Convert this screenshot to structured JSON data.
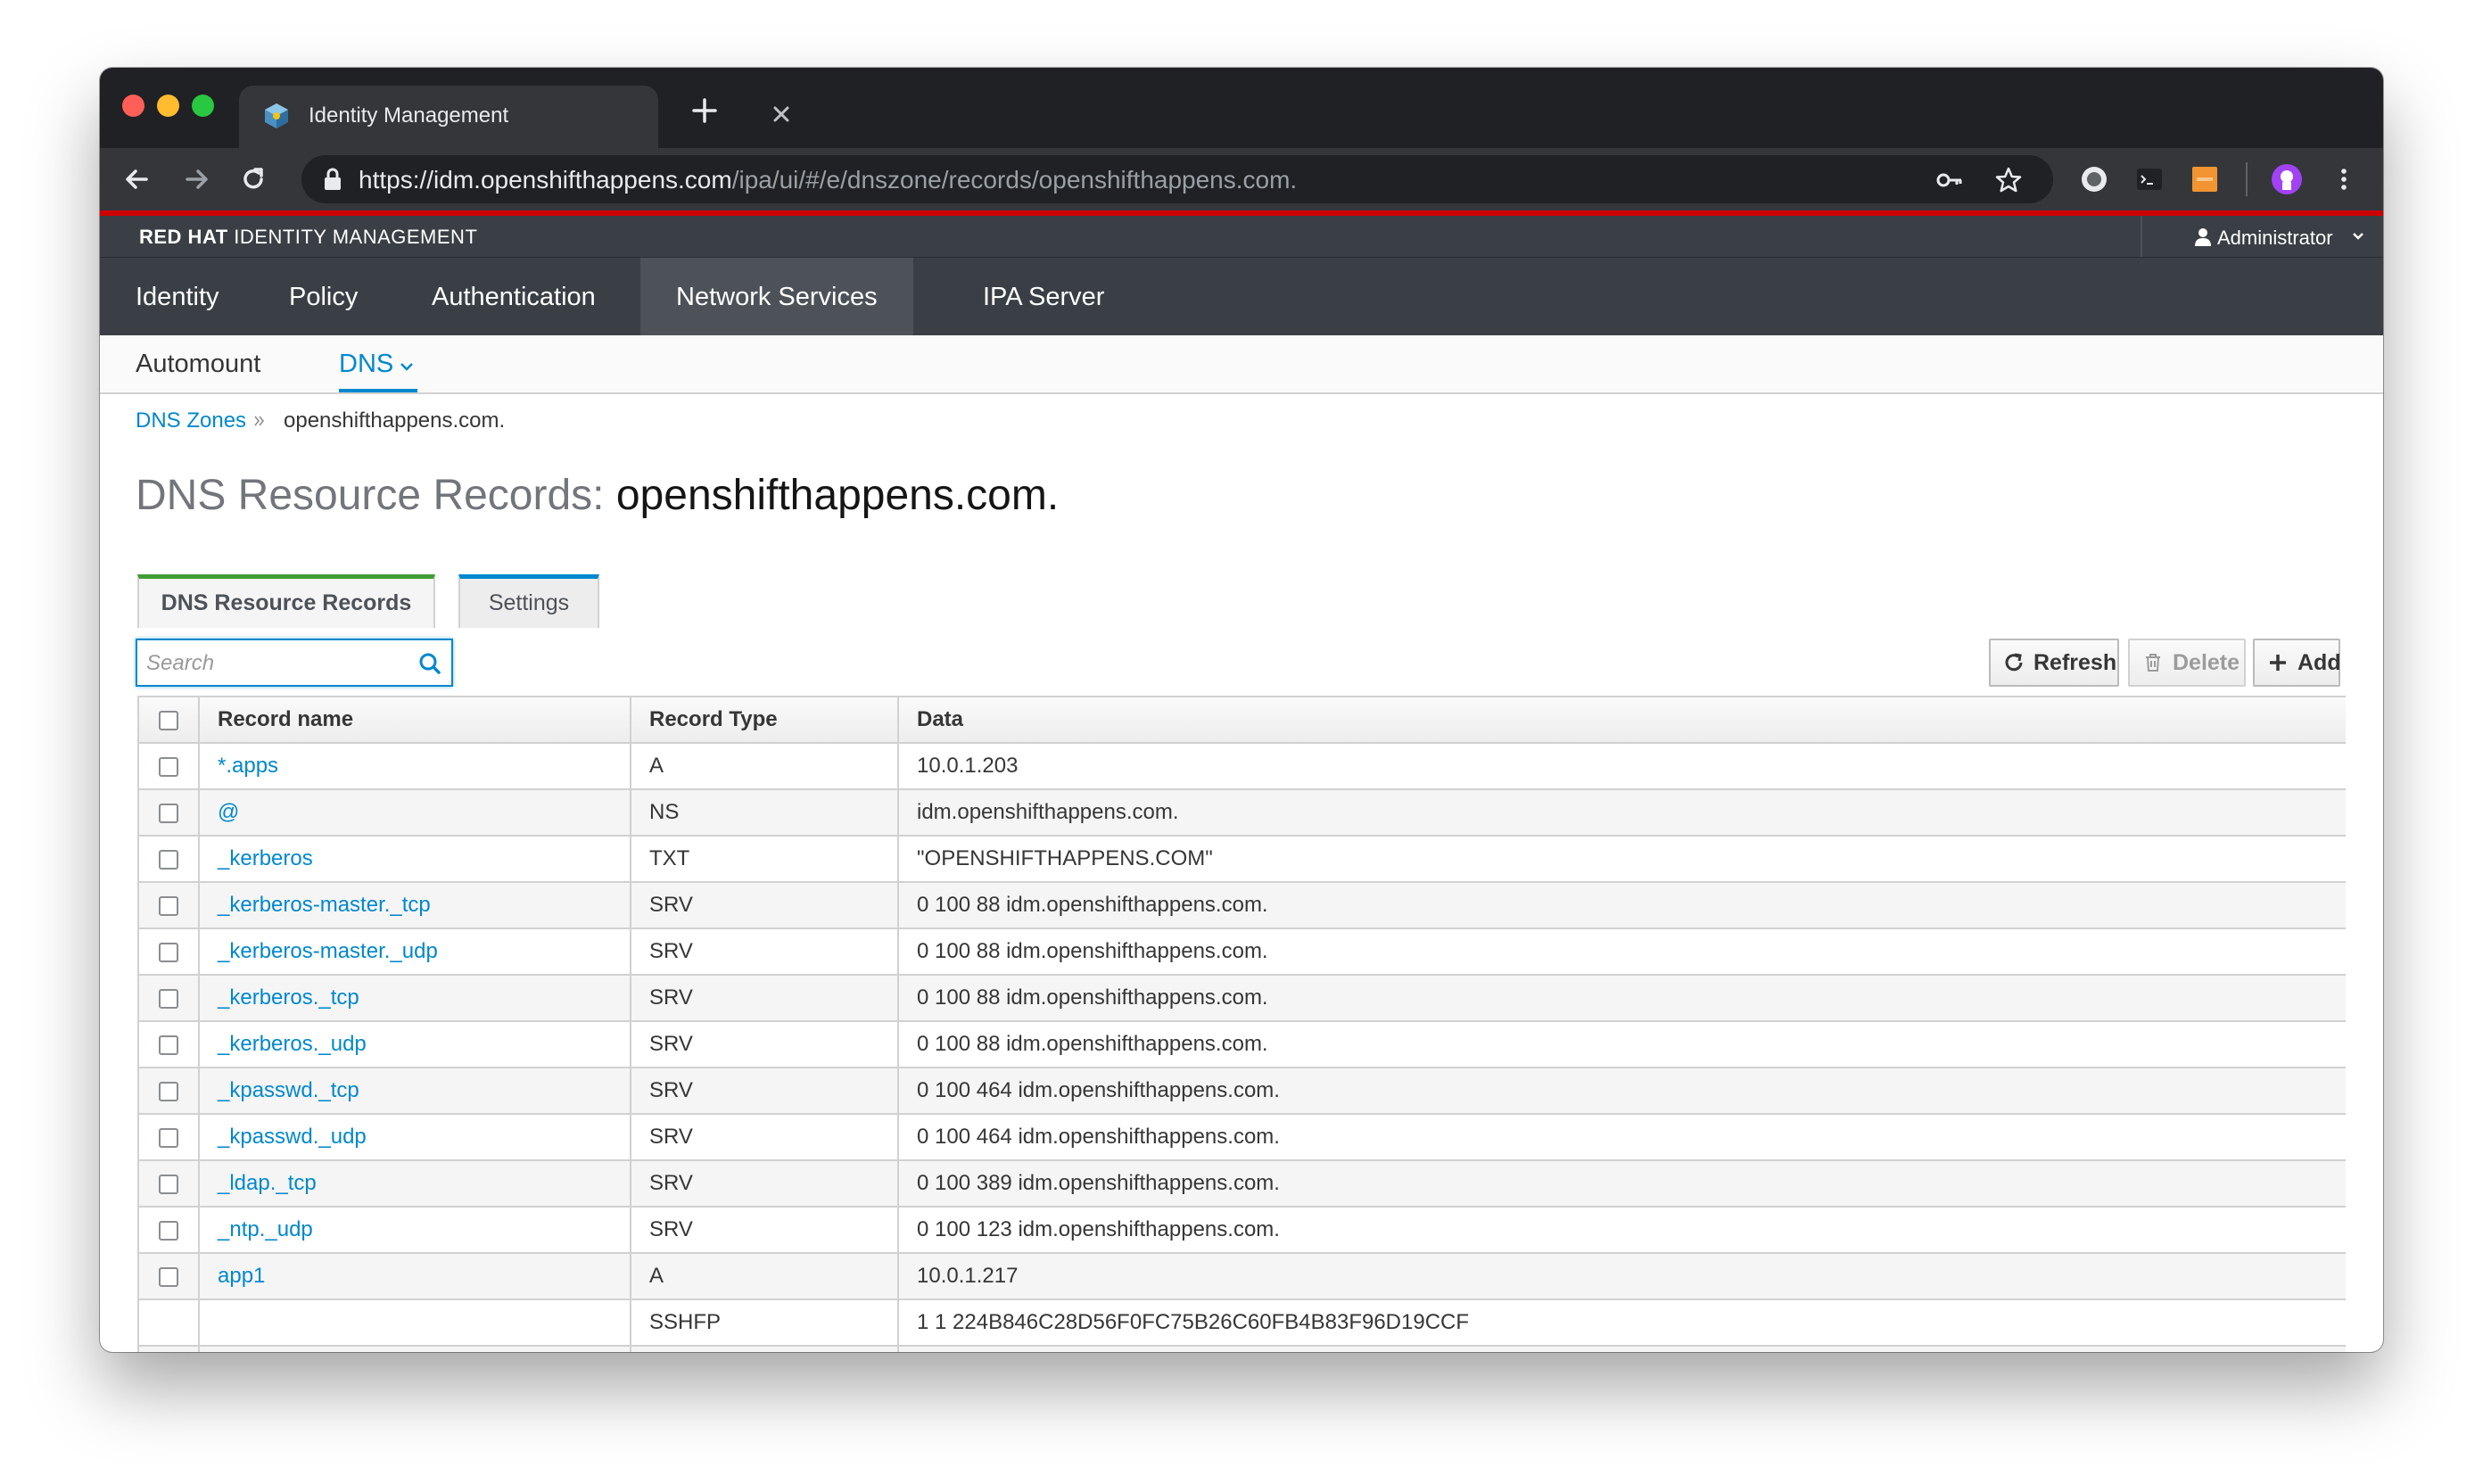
{
  "browser": {
    "tab_title": "Identity Management",
    "url_host": "https://idm.openshifthappens.com",
    "url_path": "/ipa/ui/#/e/dnszone/records/openshifthappens.com."
  },
  "masthead": {
    "brand_bold": "RED HAT",
    "brand_rest": " IDENTITY MANAGEMENT",
    "user": "Administrator"
  },
  "primary_nav": {
    "items": [
      {
        "label": "Identity"
      },
      {
        "label": "Policy"
      },
      {
        "label": "Authentication"
      },
      {
        "label": "Network Services"
      },
      {
        "label": "IPA Server"
      }
    ]
  },
  "secondary_nav": {
    "items": [
      {
        "label": "Automount"
      },
      {
        "label": "DNS"
      }
    ]
  },
  "breadcrumb": {
    "parent": "DNS Zones",
    "current": "openshifthappens.com."
  },
  "page": {
    "title_prefix": "DNS Resource Records: ",
    "title_zone": "openshifthappens.com."
  },
  "content_tabs": [
    {
      "label": "DNS Resource Records"
    },
    {
      "label": "Settings"
    }
  ],
  "search": {
    "placeholder": "Search"
  },
  "actions": {
    "refresh": "Refresh",
    "delete": "Delete",
    "add": "Add"
  },
  "table": {
    "columns": [
      "Record name",
      "Record Type",
      "Data"
    ],
    "rows": [
      {
        "name": "*.apps",
        "type": "A",
        "data": "10.0.1.203"
      },
      {
        "name": "@",
        "type": "NS",
        "data": "idm.openshifthappens.com."
      },
      {
        "name": "_kerberos",
        "type": "TXT",
        "data": "\"OPENSHIFTHAPPENS.COM\""
      },
      {
        "name": "_kerberos-master._tcp",
        "type": "SRV",
        "data": "0 100 88 idm.openshifthappens.com."
      },
      {
        "name": "_kerberos-master._udp",
        "type": "SRV",
        "data": "0 100 88 idm.openshifthappens.com."
      },
      {
        "name": "_kerberos._tcp",
        "type": "SRV",
        "data": "0 100 88 idm.openshifthappens.com."
      },
      {
        "name": "_kerberos._udp",
        "type": "SRV",
        "data": "0 100 88 idm.openshifthappens.com."
      },
      {
        "name": "_kpasswd._tcp",
        "type": "SRV",
        "data": "0 100 464 idm.openshifthappens.com."
      },
      {
        "name": "_kpasswd._udp",
        "type": "SRV",
        "data": "0 100 464 idm.openshifthappens.com."
      },
      {
        "name": "_ldap._tcp",
        "type": "SRV",
        "data": "0 100 389 idm.openshifthappens.com."
      },
      {
        "name": "_ntp._udp",
        "type": "SRV",
        "data": "0 100 123 idm.openshifthappens.com."
      },
      {
        "name": "app1",
        "type": "A",
        "data": "10.0.1.217"
      },
      {
        "name": "",
        "type": "SSHFP",
        "data": "1 1 224B846C28D56F0FC75B26C60FB4B83F96D19CCF"
      },
      {
        "name": "",
        "type": "",
        "data": ""
      }
    ]
  },
  "colors": {
    "accent_red": "#cc0000",
    "link_blue": "#0088ce",
    "tab_green": "#3f9c35",
    "nav_bg": "#393f44"
  },
  "icons": [
    "padlock-icon",
    "key-icon",
    "star-icon",
    "search-icon",
    "refresh-icon",
    "trash-icon",
    "plus-icon",
    "user-icon"
  ]
}
